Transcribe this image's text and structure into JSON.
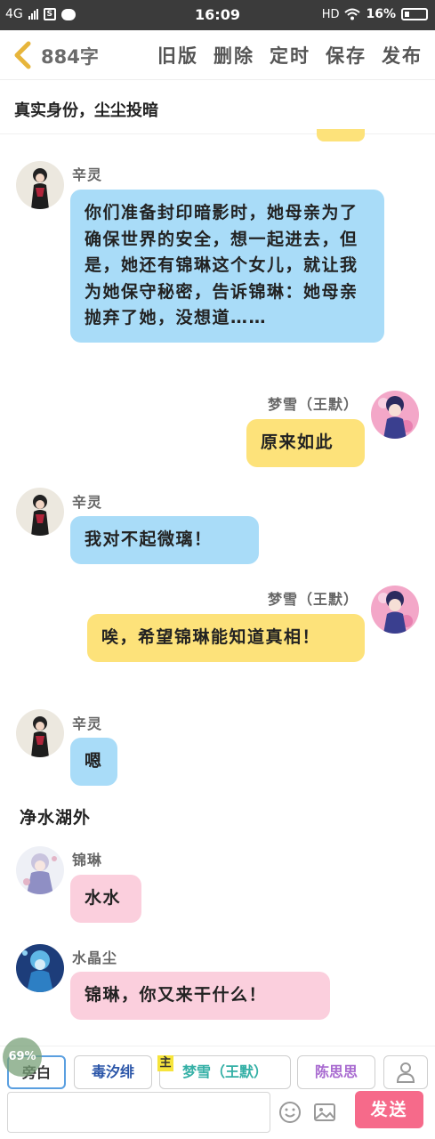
{
  "status_bar": {
    "network": "4G",
    "time": "16:09",
    "hd": "HD",
    "battery": "16%"
  },
  "top_bar": {
    "word_count": "884字",
    "actions": [
      "旧版",
      "删除",
      "定时",
      "保存",
      "发布"
    ]
  },
  "chapter_title": "真实身份，尘尘投暗",
  "messages": [
    {
      "speaker": "辛灵",
      "side": "left",
      "color": "blue",
      "text": "你们准备封印暗影时，她母亲为了确保世界的安全，想一起进去，但是，她还有锦琳这个女儿，就让我为她保守秘密，告诉锦琳：她母亲抛弃了她，没想道……"
    },
    {
      "speaker": "梦雪（王默）",
      "side": "right",
      "color": "yellow",
      "text": "原来如此"
    },
    {
      "speaker": "辛灵",
      "side": "left",
      "color": "blue",
      "text": "我对不起微璃！"
    },
    {
      "speaker": "梦雪（王默）",
      "side": "right",
      "color": "yellow",
      "text": "唉，希望锦琳能知道真相！"
    },
    {
      "speaker": "辛灵",
      "side": "left",
      "color": "blue",
      "text": "嗯"
    },
    {
      "speaker": "锦琳",
      "side": "left",
      "color": "pink",
      "text": "水水"
    },
    {
      "speaker": "水晶尘",
      "side": "left",
      "color": "pink",
      "text": "锦琳，你又来干什么！"
    }
  ],
  "narration": "净水湖外",
  "roles": {
    "narrator": "旁白",
    "du": "毒汐绯",
    "main_tag": "主",
    "meng": "梦雪（王默）",
    "chen": "陈思思"
  },
  "float_badge": "69%",
  "input": {
    "value": "",
    "placeholder": ""
  },
  "send_label": "发送",
  "colors": {
    "blue_bubble": "#a9dcf8",
    "yellow_bubble": "#fde27a",
    "pink_bubble": "#fbcfdd",
    "send_button": "#f66a8a"
  }
}
